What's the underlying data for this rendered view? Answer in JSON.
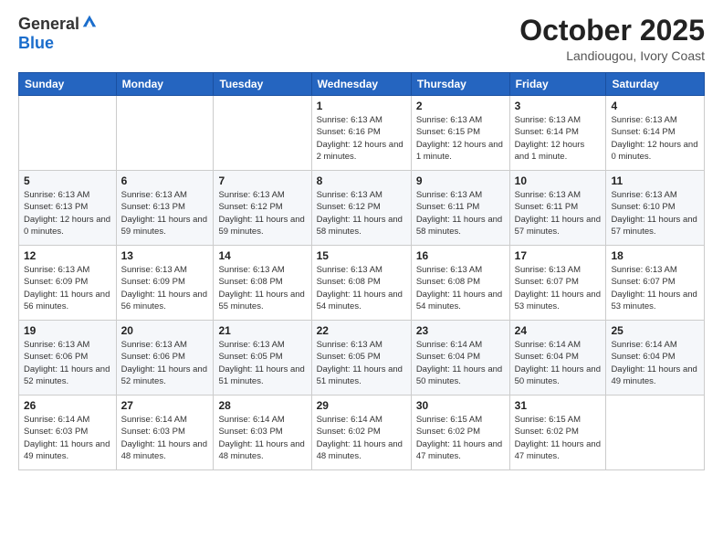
{
  "header": {
    "logo_general": "General",
    "logo_blue": "Blue",
    "month_title": "October 2025",
    "location": "Landiougou, Ivory Coast"
  },
  "days_of_week": [
    "Sunday",
    "Monday",
    "Tuesday",
    "Wednesday",
    "Thursday",
    "Friday",
    "Saturday"
  ],
  "weeks": [
    [
      {
        "day": "",
        "info": ""
      },
      {
        "day": "",
        "info": ""
      },
      {
        "day": "",
        "info": ""
      },
      {
        "day": "1",
        "info": "Sunrise: 6:13 AM\nSunset: 6:16 PM\nDaylight: 12 hours and 2 minutes."
      },
      {
        "day": "2",
        "info": "Sunrise: 6:13 AM\nSunset: 6:15 PM\nDaylight: 12 hours and 1 minute."
      },
      {
        "day": "3",
        "info": "Sunrise: 6:13 AM\nSunset: 6:14 PM\nDaylight: 12 hours and 1 minute."
      },
      {
        "day": "4",
        "info": "Sunrise: 6:13 AM\nSunset: 6:14 PM\nDaylight: 12 hours and 0 minutes."
      }
    ],
    [
      {
        "day": "5",
        "info": "Sunrise: 6:13 AM\nSunset: 6:13 PM\nDaylight: 12 hours and 0 minutes."
      },
      {
        "day": "6",
        "info": "Sunrise: 6:13 AM\nSunset: 6:13 PM\nDaylight: 11 hours and 59 minutes."
      },
      {
        "day": "7",
        "info": "Sunrise: 6:13 AM\nSunset: 6:12 PM\nDaylight: 11 hours and 59 minutes."
      },
      {
        "day": "8",
        "info": "Sunrise: 6:13 AM\nSunset: 6:12 PM\nDaylight: 11 hours and 58 minutes."
      },
      {
        "day": "9",
        "info": "Sunrise: 6:13 AM\nSunset: 6:11 PM\nDaylight: 11 hours and 58 minutes."
      },
      {
        "day": "10",
        "info": "Sunrise: 6:13 AM\nSunset: 6:11 PM\nDaylight: 11 hours and 57 minutes."
      },
      {
        "day": "11",
        "info": "Sunrise: 6:13 AM\nSunset: 6:10 PM\nDaylight: 11 hours and 57 minutes."
      }
    ],
    [
      {
        "day": "12",
        "info": "Sunrise: 6:13 AM\nSunset: 6:09 PM\nDaylight: 11 hours and 56 minutes."
      },
      {
        "day": "13",
        "info": "Sunrise: 6:13 AM\nSunset: 6:09 PM\nDaylight: 11 hours and 56 minutes."
      },
      {
        "day": "14",
        "info": "Sunrise: 6:13 AM\nSunset: 6:08 PM\nDaylight: 11 hours and 55 minutes."
      },
      {
        "day": "15",
        "info": "Sunrise: 6:13 AM\nSunset: 6:08 PM\nDaylight: 11 hours and 54 minutes."
      },
      {
        "day": "16",
        "info": "Sunrise: 6:13 AM\nSunset: 6:08 PM\nDaylight: 11 hours and 54 minutes."
      },
      {
        "day": "17",
        "info": "Sunrise: 6:13 AM\nSunset: 6:07 PM\nDaylight: 11 hours and 53 minutes."
      },
      {
        "day": "18",
        "info": "Sunrise: 6:13 AM\nSunset: 6:07 PM\nDaylight: 11 hours and 53 minutes."
      }
    ],
    [
      {
        "day": "19",
        "info": "Sunrise: 6:13 AM\nSunset: 6:06 PM\nDaylight: 11 hours and 52 minutes."
      },
      {
        "day": "20",
        "info": "Sunrise: 6:13 AM\nSunset: 6:06 PM\nDaylight: 11 hours and 52 minutes."
      },
      {
        "day": "21",
        "info": "Sunrise: 6:13 AM\nSunset: 6:05 PM\nDaylight: 11 hours and 51 minutes."
      },
      {
        "day": "22",
        "info": "Sunrise: 6:13 AM\nSunset: 6:05 PM\nDaylight: 11 hours and 51 minutes."
      },
      {
        "day": "23",
        "info": "Sunrise: 6:14 AM\nSunset: 6:04 PM\nDaylight: 11 hours and 50 minutes."
      },
      {
        "day": "24",
        "info": "Sunrise: 6:14 AM\nSunset: 6:04 PM\nDaylight: 11 hours and 50 minutes."
      },
      {
        "day": "25",
        "info": "Sunrise: 6:14 AM\nSunset: 6:04 PM\nDaylight: 11 hours and 49 minutes."
      }
    ],
    [
      {
        "day": "26",
        "info": "Sunrise: 6:14 AM\nSunset: 6:03 PM\nDaylight: 11 hours and 49 minutes."
      },
      {
        "day": "27",
        "info": "Sunrise: 6:14 AM\nSunset: 6:03 PM\nDaylight: 11 hours and 48 minutes."
      },
      {
        "day": "28",
        "info": "Sunrise: 6:14 AM\nSunset: 6:03 PM\nDaylight: 11 hours and 48 minutes."
      },
      {
        "day": "29",
        "info": "Sunrise: 6:14 AM\nSunset: 6:02 PM\nDaylight: 11 hours and 48 minutes."
      },
      {
        "day": "30",
        "info": "Sunrise: 6:15 AM\nSunset: 6:02 PM\nDaylight: 11 hours and 47 minutes."
      },
      {
        "day": "31",
        "info": "Sunrise: 6:15 AM\nSunset: 6:02 PM\nDaylight: 11 hours and 47 minutes."
      },
      {
        "day": "",
        "info": ""
      }
    ]
  ]
}
